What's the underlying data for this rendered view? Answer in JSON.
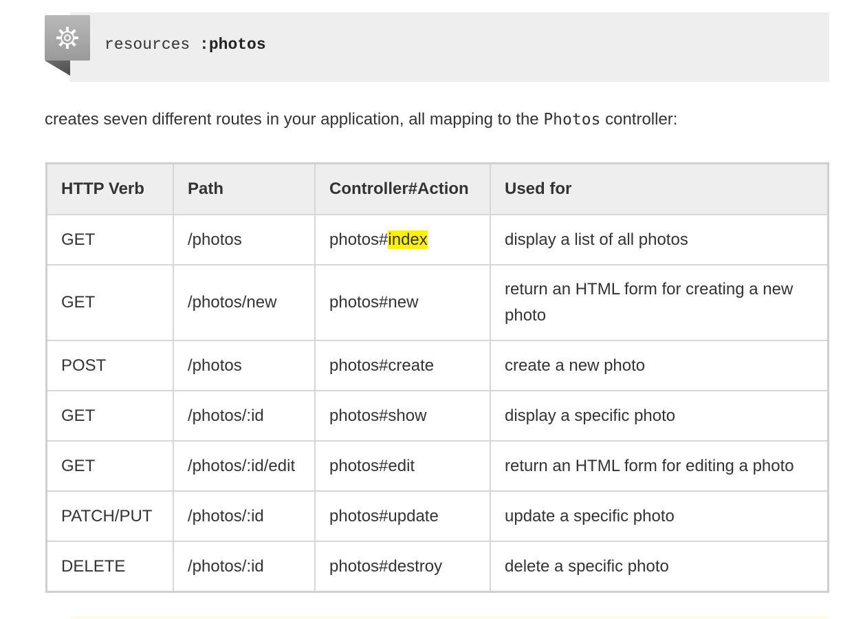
{
  "code_block": {
    "keyword": "resources",
    "symbol": ":photos",
    "icon": "gear-icon"
  },
  "intro": {
    "before": "creates seven different routes in your application, all mapping to the ",
    "code": "Photos",
    "after": " controller:"
  },
  "table": {
    "headers": [
      "HTTP Verb",
      "Path",
      "Controller#Action",
      "Used for"
    ],
    "rows": [
      {
        "verb": "GET",
        "path": "/photos",
        "action_prefix": "photos#",
        "action_name": "index",
        "used_for": "display a list of all photos"
      },
      {
        "verb": "GET",
        "path": "/photos/new",
        "action_prefix": "photos#",
        "action_name": "new",
        "used_for": "return an HTML form for creating a new photo"
      },
      {
        "verb": "POST",
        "path": "/photos",
        "action_prefix": "photos#",
        "action_name": "create",
        "used_for": "create a new photo"
      },
      {
        "verb": "GET",
        "path": "/photos/:id",
        "action_prefix": "photos#",
        "action_name": "show",
        "used_for": "display a specific photo"
      },
      {
        "verb": "GET",
        "path": "/photos/:id/edit",
        "action_prefix": "photos#",
        "action_name": "edit",
        "used_for": "return an HTML form for editing a photo"
      },
      {
        "verb": "PATCH/PUT",
        "path": "/photos/:id",
        "action_prefix": "photos#",
        "action_name": "update",
        "used_for": "update a specific photo"
      },
      {
        "verb": "DELETE",
        "path": "/photos/:id",
        "action_prefix": "photos#",
        "action_name": "destroy",
        "used_for": "delete a specific photo"
      }
    ]
  },
  "colors": {
    "highlight": "#fff200",
    "code_background": "#eeeeee",
    "header_background": "#eeeeee",
    "border": "#d6d6d6"
  }
}
